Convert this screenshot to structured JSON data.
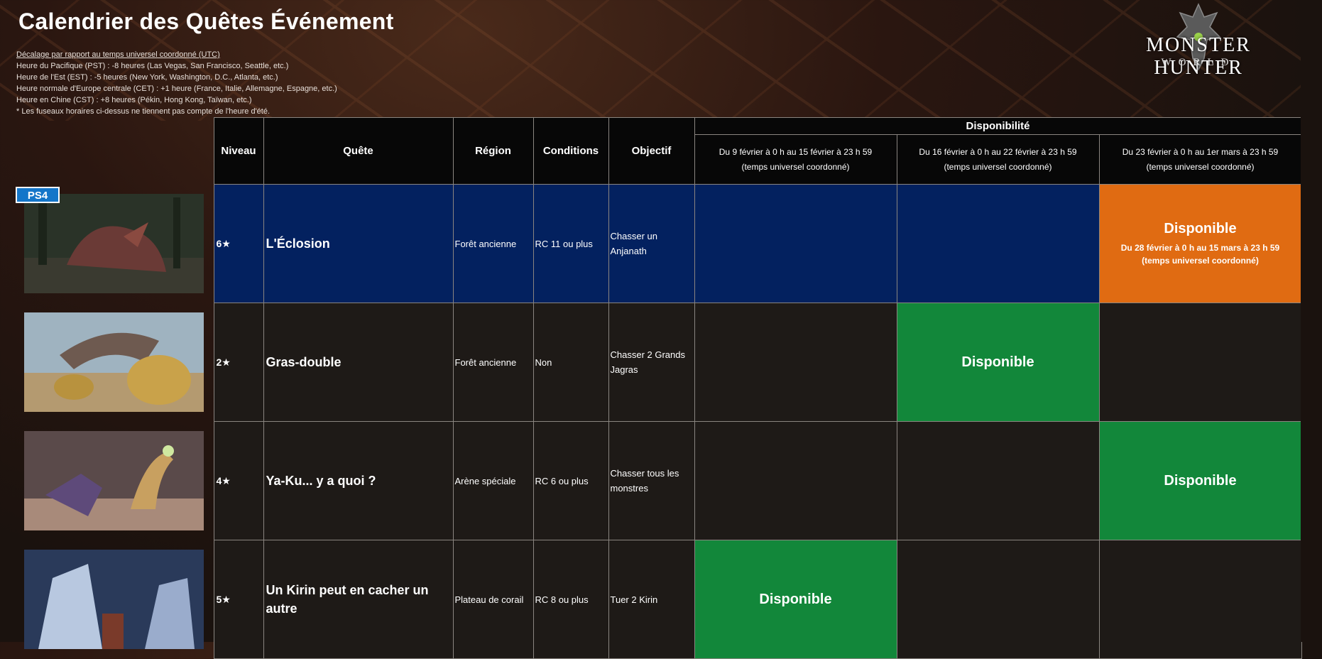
{
  "page": {
    "title": "Calendrier des Quêtes Événement",
    "tz_lines": [
      "Décalage par rapport au temps universel coordonné (UTC)",
      "Heure du Pacifique (PST) : -8 heures (Las Vegas, San Francisco, Seattle, etc.)",
      "Heure de l'Est (EST) : -5 heures (New York, Washington, D.C., Atlanta, etc.)",
      "Heure normale d'Europe centrale (CET) : +1 heure (France, Italie, Allemagne, Espagne, etc.)",
      "Heure en Chine (CST) : +8 heures (Pékin, Hong Kong, Taïwan, etc.)",
      "* Les fuseaux horaires ci-dessus ne tiennent pas compte de l'heure d'été."
    ]
  },
  "logo": {
    "line1": "MONSTER HUNTER",
    "line2": "WORLD"
  },
  "table": {
    "headers": {
      "niveau": "Niveau",
      "quete": "Quête",
      "region": "Région",
      "conditions": "Conditions",
      "objectif": "Objectif",
      "disponibilite": "Disponibilité",
      "periods": [
        {
          "line1": "Du 9 février à 0 h au 15 février à 23 h 59",
          "line2": "(temps universel coordonné)"
        },
        {
          "line1": "Du 16 février à 0 h au 22 février à 23 h 59",
          "line2": "(temps universel coordonné)"
        },
        {
          "line1": "Du 23 février à 0 h au 1er mars à 23 h 59",
          "line2": "(temps universel coordonné)"
        }
      ]
    },
    "platform_badge": "PS4",
    "rows": [
      {
        "level": "6★",
        "quest": "L'Éclosion",
        "region": "Forêt ancienne",
        "conditions": "RC 11 ou plus",
        "objective": "Chasser un Anjanath",
        "availability_label": "Disponible",
        "availability_sub1": "Du 28 février à 0 h au 15 mars à 23 h 59",
        "availability_sub2": "(temps universel coordonné)"
      },
      {
        "level": "2★",
        "quest": "Gras-double",
        "region": "Forêt ancienne",
        "conditions": "Non",
        "objective": "Chasser 2 Grands Jagras",
        "availability_label": "Disponible"
      },
      {
        "level": "4★",
        "quest": "Ya-Ku... y a quoi ?",
        "region": "Arène spéciale",
        "conditions": "RC 6 ou plus",
        "objective": "Chasser tous les monstres",
        "availability_label": "Disponible"
      },
      {
        "level": "5★",
        "quest": "Un Kirin peut en cacher un autre",
        "region": "Plateau de corail",
        "conditions": "RC 8 ou plus",
        "objective": "Tuer 2 Kirin",
        "availability_label": "Disponible"
      }
    ]
  },
  "colors": {
    "blue_row": "#03215f",
    "dark_row": "#1e1a17",
    "available_green": "#12873a",
    "available_orange": "#e06b12",
    "ps4_badge": "#1476c9"
  }
}
